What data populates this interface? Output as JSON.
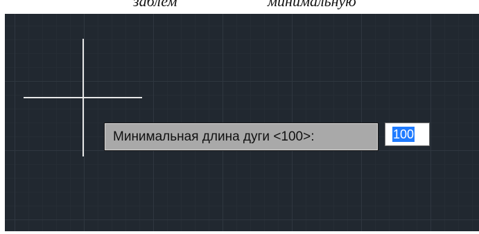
{
  "caption": {
    "left_text": "заблем",
    "right_text": "минимальную"
  },
  "dynamic_input": {
    "prompt": "Минимальная длина дуги <100>:",
    "value": "100"
  },
  "colors": {
    "canvas_background": "#212830",
    "crosshair": "#e8e8e8",
    "prompt_background": "#a9a9a9",
    "selection_highlight": "#1f7bff"
  },
  "icons": [
    "crosshair-cursor"
  ]
}
